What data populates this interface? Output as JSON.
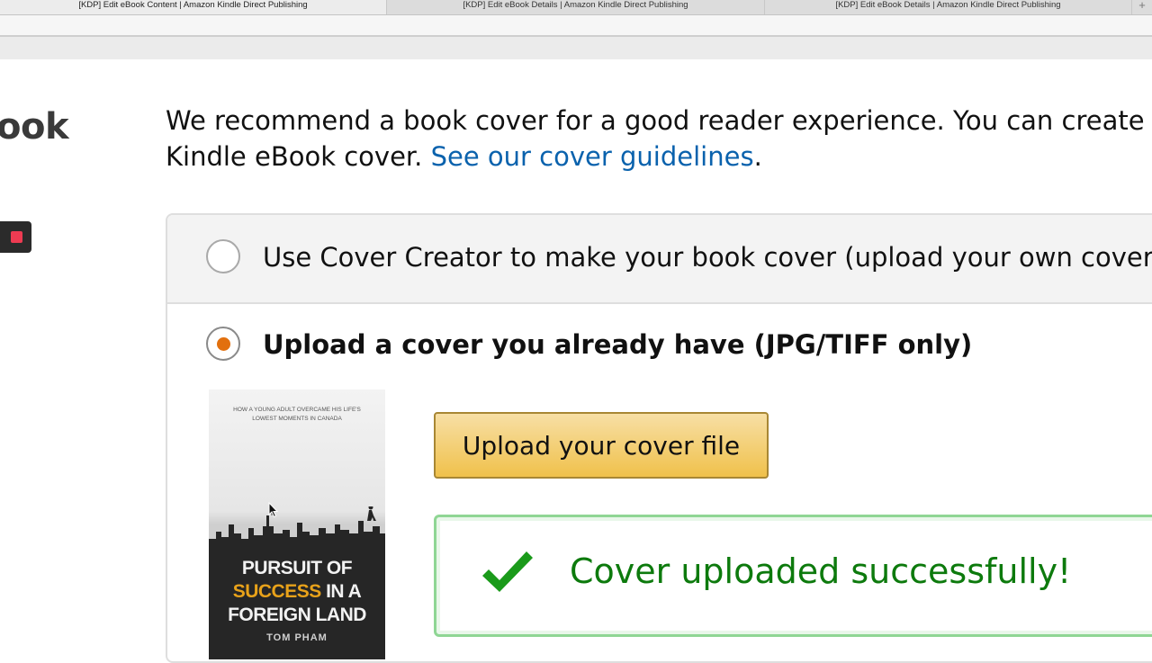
{
  "browser": {
    "tabs": [
      {
        "title": "[KDP] Edit eBook Content | Amazon Kindle Direct Publishing",
        "active": true
      },
      {
        "title": "[KDP] Edit eBook Details | Amazon Kindle Direct Publishing",
        "active": false
      },
      {
        "title": "[KDP] Edit eBook Details | Amazon Kindle Direct Publishing",
        "active": false
      }
    ],
    "new_tab_symbol": "+"
  },
  "sidebar": {
    "heading_fragment": "ook",
    "record_icon": "record-stop-icon",
    "record_color": "#ee3b52"
  },
  "intro": {
    "line1": "We recommend a book cover for a good reader experience. You can create a",
    "line2_prefix": "Kindle eBook cover. ",
    "link_text": "See our cover guidelines",
    "line2_suffix": "."
  },
  "cover_options": {
    "option1_label": "Use Cover Creator to make your book cover (upload your own cover image",
    "option1_selected": false,
    "option2_label": "Upload a cover you already have (JPG/TIFF only)",
    "option2_selected": true,
    "accent_color": "#e2700e"
  },
  "cover_preview": {
    "tagline_line1": "HOW A YOUNG ADULT OVERCAME HIS LIFE'S",
    "tagline_line2": "LOWEST MOMENTS IN CANADA",
    "title_line1": "PURSUIT OF",
    "title_highlight": "SUCCESS",
    "title_line2_rest": " IN A",
    "title_line3": "FOREIGN LAND",
    "author": "TOM PHAM"
  },
  "upload": {
    "button_label": "Upload your cover file"
  },
  "status": {
    "success_message": "Cover uploaded successfully!",
    "icon": "checkmark-icon",
    "color": "#0d7a0d"
  }
}
